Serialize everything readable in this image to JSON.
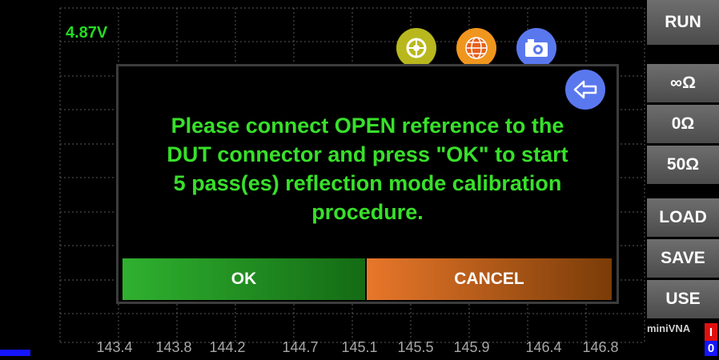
{
  "status": {
    "voltage": "4.87V"
  },
  "toolbar": {
    "icons": [
      "crosshair-icon",
      "globe-icon",
      "camera-icon",
      "back-arrow-icon"
    ],
    "colors": {
      "crosshair": "#b8b81e",
      "globe": "#f0961e",
      "camera": "#5a78ee",
      "back": "#5a78ee"
    }
  },
  "dialog": {
    "message_lines": [
      "Please connect OPEN reference to the",
      "DUT connector and press \"OK\" to start",
      "5 pass(es) reflection mode calibration",
      "procedure."
    ],
    "ok_label": "OK",
    "cancel_label": "CANCEL",
    "colors": {
      "text": "#38e02a",
      "ok": "#2fb12f",
      "cancel": "#e8772a"
    }
  },
  "x_axis": {
    "ticks": [
      "143.4",
      "143.8",
      "144.2",
      "144.7",
      "145.1",
      "145.5",
      "145.9",
      "146.4",
      "146.8"
    ]
  },
  "sidebar": {
    "run_label": "RUN",
    "open_label": "∞Ω",
    "short_label": "0Ω",
    "load50_label": "50Ω",
    "load_label": "LOAD",
    "save_label": "SAVE",
    "use_label": "USE",
    "brand": "miniVNA",
    "marker_top": "I",
    "marker_bottom": "0"
  }
}
